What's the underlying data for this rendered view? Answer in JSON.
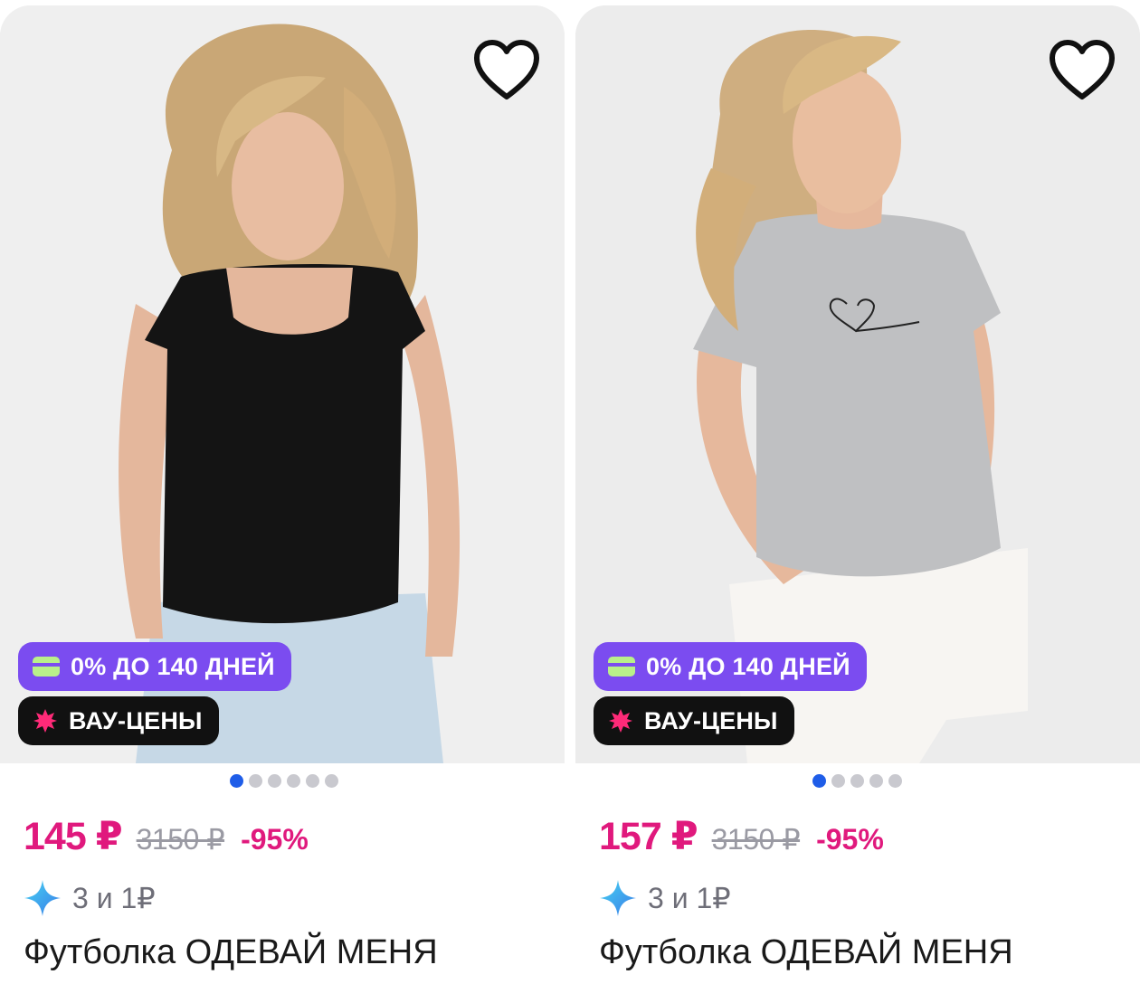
{
  "products": [
    {
      "favorite_icon": "heart-outline-icon",
      "badges": {
        "installment": "0% ДО 140 ДНЕЙ",
        "wow": "ВАУ-ЦЕНЫ"
      },
      "image_dots_total": 6,
      "image_dots_active": 0,
      "price_current": "145 ₽",
      "price_old": "3150 ₽",
      "discount": "-95%",
      "points": "3 и 1₽",
      "title": "Футболка ОДЕВАЙ МЕНЯ"
    },
    {
      "favorite_icon": "heart-outline-icon",
      "badges": {
        "installment": "0% ДО 140 ДНЕЙ",
        "wow": "ВАУ-ЦЕНЫ"
      },
      "image_dots_total": 5,
      "image_dots_active": 0,
      "price_current": "157 ₽",
      "price_old": "3150 ₽",
      "discount": "-95%",
      "points": "3 и 1₽",
      "title": "Футболка ОДЕВАЙ МЕНЯ"
    }
  ],
  "colors": {
    "price": "#e0197d",
    "installment_badge": "#7b4cf0",
    "wow_badge": "#111111",
    "dot_active": "#1f5de8"
  }
}
